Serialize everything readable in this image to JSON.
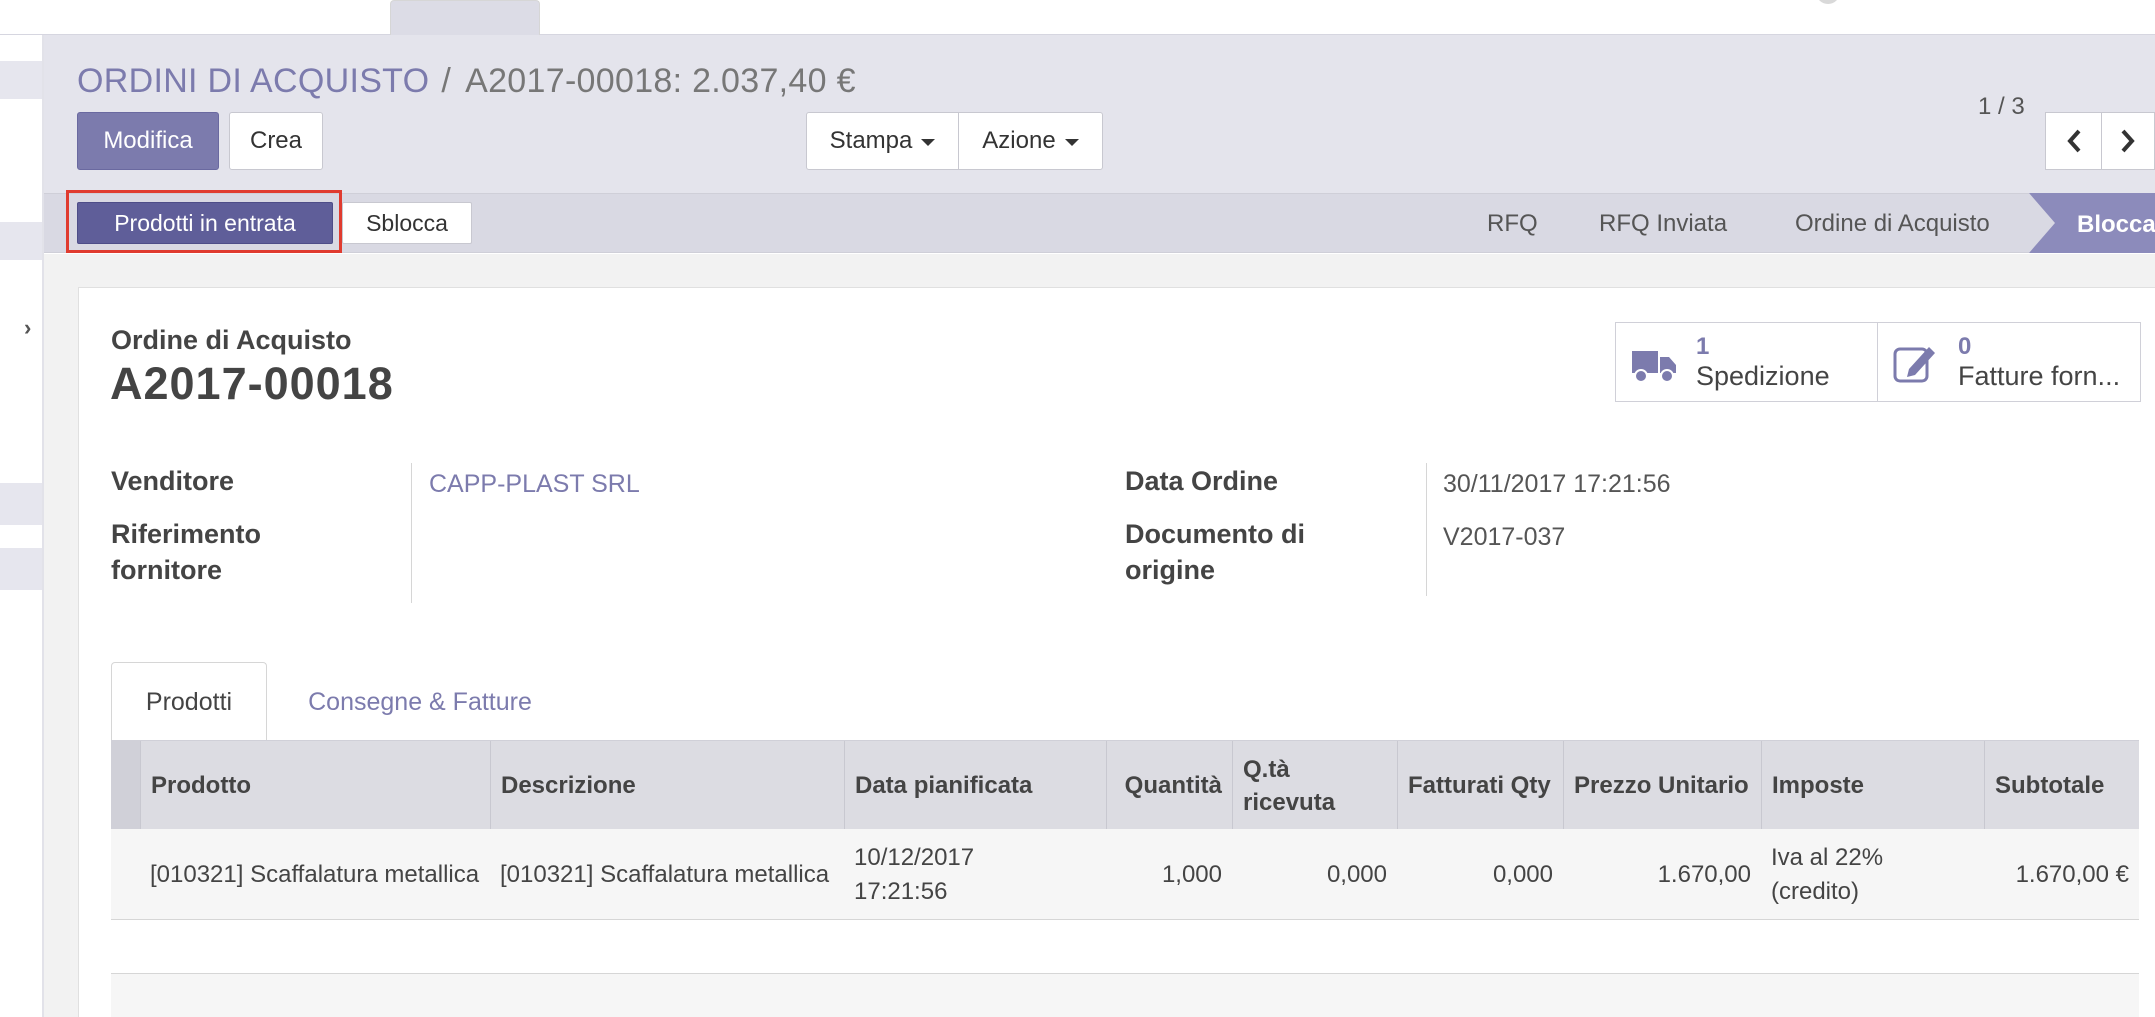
{
  "breadcrumb": {
    "parent": "ORDINI DI ACQUISTO",
    "separator": "/",
    "current": "A2017-00018: 2.037,40 €"
  },
  "toolbar": {
    "edit_label": "Modifica",
    "create_label": "Crea",
    "print_label": "Stampa",
    "action_label": "Azione"
  },
  "pager": {
    "value": "1 / 3"
  },
  "statusbar": {
    "receive_label": "Prodotti in entrata",
    "unlock_label": "Sblocca",
    "stages": [
      "RFQ",
      "RFQ Inviata",
      "Ordine di Acquisto",
      "Bloccato"
    ],
    "active_stage": "Bloccato"
  },
  "form": {
    "doc_type": "Ordine di Acquisto",
    "doc_name": "A2017-00018",
    "smart_buttons": [
      {
        "count": "1",
        "label": "Spedizione",
        "icon": "truck-icon"
      },
      {
        "count": "0",
        "label": "Fatture forn...",
        "icon": "pencil-square-icon"
      }
    ],
    "fields": {
      "vendor_label": "Venditore",
      "vendor_value": "CAPP-PLAST SRL",
      "vendor_ref_label": "Riferimento fornitore",
      "vendor_ref_value": "",
      "order_date_label": "Data Ordine",
      "order_date_value": "30/11/2017 17:21:56",
      "source_doc_label": "Documento di origine",
      "source_doc_value": "V2017-037"
    },
    "tabs": [
      "Prodotti",
      "Consegne & Fatture"
    ]
  },
  "table": {
    "columns": [
      "Prodotto",
      "Descrizione",
      "Data pianificata",
      "Quantità",
      "Q.tà ricevuta",
      "Fatturati Qty",
      "Prezzo Unitario",
      "Imposte",
      "Subtotale"
    ],
    "rows": [
      [
        "[010321] Scaffalatura metallica",
        "[010321] Scaffalatura metallica",
        "10/12/2017 17:21:56",
        "1,000",
        "0,000",
        "0,000",
        "1.670,00",
        "Iva al 22% (credito)",
        "1.670,00 €"
      ]
    ]
  },
  "colors": {
    "primary": "#7c7bad",
    "primary_dark": "#5f5e99",
    "highlight": "#e03b2f",
    "control_bg": "#e4e4ec"
  }
}
